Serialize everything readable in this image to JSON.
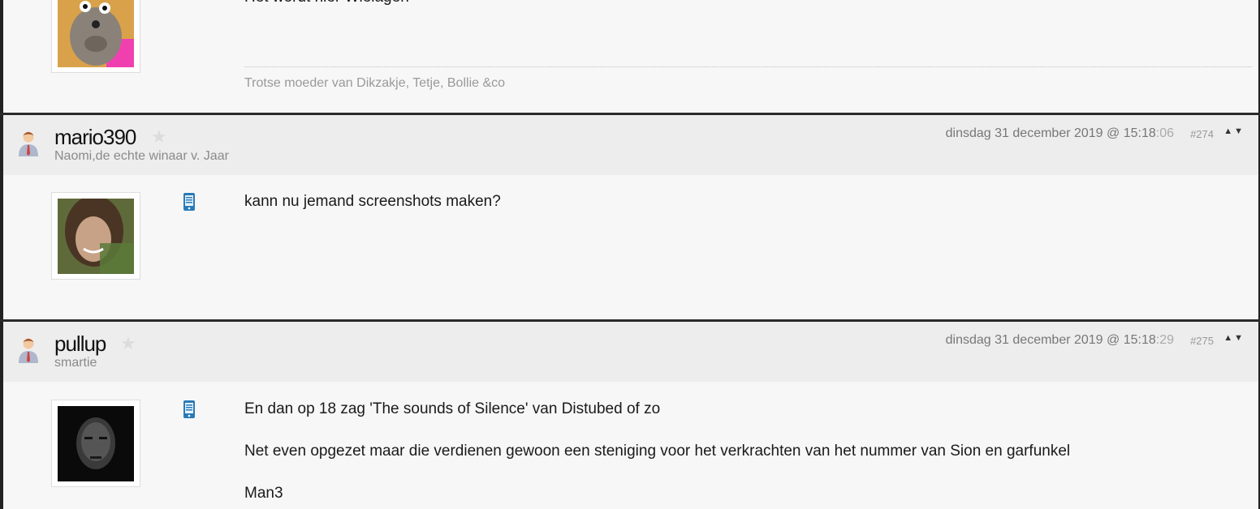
{
  "post_prev": {
    "message_partial": "Het wordt hier Wielagen",
    "signature": "Trotse moeder van Dikzakje, Tetje, Bollie &co"
  },
  "post_274": {
    "username": "mario390",
    "user_title": "Naomi,de echte winaar v. Jaar",
    "date": "dinsdag 31 december 2019 @ 15:18",
    "seconds": ":06",
    "post_number": "#274",
    "message": "kann nu jemand screenshots maken?"
  },
  "post_275": {
    "username": "pullup",
    "user_title": "smartie",
    "date": "dinsdag 31 december 2019 @ 15:18",
    "seconds": ":29",
    "post_number": "#275",
    "messages": [
      "En dan op 18 zag 'The sounds of Silence' van Distubed of zo",
      "Net even opgezet maar die verdienen gewoon een steniging voor het verkrachten van het nummer van Sion en garfunkel",
      "Man3"
    ]
  },
  "icons": {
    "user": "user-icon",
    "star": "star-icon",
    "device": "mobile-device-icon",
    "arrows": "up-down-arrows-icon"
  }
}
